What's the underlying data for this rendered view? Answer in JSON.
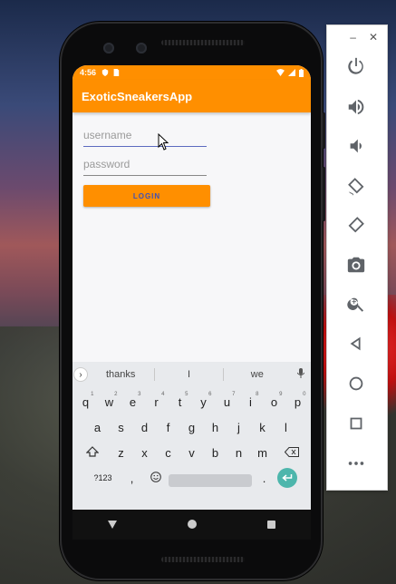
{
  "status_bar": {
    "time": "4:56"
  },
  "app_bar": {
    "title": "ExoticSneakersApp"
  },
  "login_form": {
    "username_placeholder": "username",
    "password_placeholder": "password",
    "login_label": "LOGIN"
  },
  "keyboard": {
    "suggestions": [
      "thanks",
      "I",
      "we"
    ],
    "row1": [
      {
        "key": "q",
        "hint": "1"
      },
      {
        "key": "w",
        "hint": "2"
      },
      {
        "key": "e",
        "hint": "3"
      },
      {
        "key": "r",
        "hint": "4"
      },
      {
        "key": "t",
        "hint": "5"
      },
      {
        "key": "y",
        "hint": "6"
      },
      {
        "key": "u",
        "hint": "7"
      },
      {
        "key": "i",
        "hint": "8"
      },
      {
        "key": "o",
        "hint": "9"
      },
      {
        "key": "p",
        "hint": "0"
      }
    ],
    "row2": [
      "a",
      "s",
      "d",
      "f",
      "g",
      "h",
      "j",
      "k",
      "l"
    ],
    "row3": [
      "z",
      "x",
      "c",
      "v",
      "b",
      "n",
      "m"
    ],
    "symbols_key": "?123",
    "comma_key": ",",
    "period_key": "."
  },
  "emulator_toolbar": {
    "minimize": "–",
    "close": "✕",
    "buttons": [
      "power-icon",
      "volume-up-icon",
      "volume-down-icon",
      "rotate-left-icon",
      "rotate-right-icon",
      "camera-icon",
      "zoom-icon",
      "back-icon",
      "home-icon",
      "overview-icon",
      "more-icon"
    ]
  },
  "colors": {
    "accent": "#ff8f00",
    "button_text": "#3f51b5",
    "enter_key": "#4db6ac"
  }
}
